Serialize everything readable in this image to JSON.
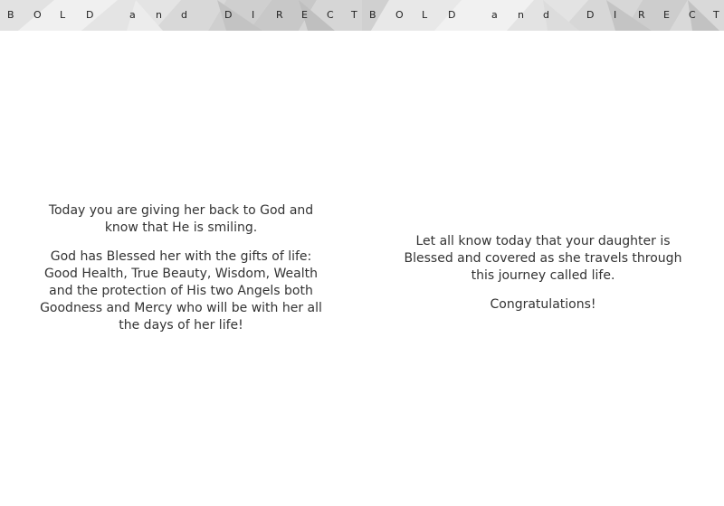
{
  "banner": {
    "left_letters": [
      "B",
      "O",
      "L",
      "D",
      "a",
      "n",
      "d",
      "D",
      "I",
      "R",
      "E",
      "C",
      "T"
    ],
    "right_letters": [
      "B",
      "O",
      "L",
      "D",
      "a",
      "n",
      "d",
      "D",
      "I",
      "R",
      "E",
      "C",
      "T"
    ],
    "background_colors": [
      "#e6e6e6",
      "#d4d4d4",
      "#c6c6c6",
      "#efefef"
    ]
  },
  "left_page": {
    "paragraph_1": "Today you are giving her back to God and know that He is smiling.",
    "paragraph_2": "God has Blessed her with the gifts of life: Good Health, True Beauty, Wisdom, Wealth and the protection of His two Angels both Goodness and Mercy who will be with her all the days of her life!"
  },
  "right_page": {
    "paragraph_1": "Let all know today that your daughter is Blessed and covered as she travels through this journey called life.",
    "paragraph_2": "Congratulations!"
  }
}
